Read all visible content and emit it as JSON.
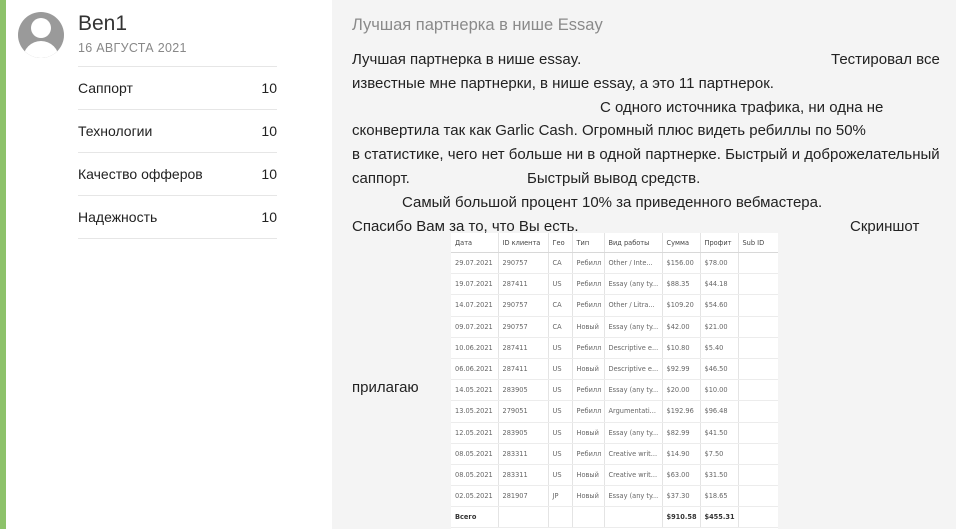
{
  "user": {
    "name": "Ben1",
    "date": "16 АВГУСТА 2021",
    "avatar_icon": "user-avatar-icon"
  },
  "ratings": [
    {
      "label": "Саппорт",
      "value": "10"
    },
    {
      "label": "Технологии",
      "value": "10"
    },
    {
      "label": "Качество офферов",
      "value": "10"
    },
    {
      "label": "Надежность",
      "value": "10"
    }
  ],
  "review": {
    "title": "Лучшая партнерка в нише Essay",
    "line1a": "Лучшая партнерка в нише essay.",
    "line1b": "Тестировал все",
    "line2": "известные мне партнерки, в нише essay, а это 11 партнерок.",
    "line3": "С одного источника трафика, ни одна не",
    "line4": "сконвертила так как Garlic Cash. Огромный плюс видеть ребиллы по 50%",
    "line5": "в статистике, чего нет больше ни в одной партнерке. Быстрый и доброжелательный",
    "line6a": "саппорт.",
    "line6b": "Быстрый вывод средств.",
    "line7": "Самый большой процент 10%  за приведенного вебмастера.",
    "line8a": "Спасибо Вам за то, что Вы есть.",
    "line8b": "Скриншот",
    "attach_caption": "прилагаю"
  },
  "screenshot_table": {
    "headers": [
      "Дата",
      "ID клиента",
      "Гео",
      "Тип",
      "Вид работы",
      "Сумма",
      "Профит",
      "Sub ID"
    ],
    "rows": [
      [
        "29.07.2021",
        "290757",
        "CA",
        "Ребилл",
        "Other / Inte...",
        "$156.00",
        "$78.00",
        ""
      ],
      [
        "19.07.2021",
        "287411",
        "US",
        "Ребилл",
        "Essay (any ty...",
        "$88.35",
        "$44.18",
        ""
      ],
      [
        "14.07.2021",
        "290757",
        "CA",
        "Ребилл",
        "Other / Litra...",
        "$109.20",
        "$54.60",
        ""
      ],
      [
        "09.07.2021",
        "290757",
        "CA",
        "Новый",
        "Essay (any ty...",
        "$42.00",
        "$21.00",
        ""
      ],
      [
        "10.06.2021",
        "287411",
        "US",
        "Ребилл",
        "Descriptive e...",
        "$10.80",
        "$5.40",
        ""
      ],
      [
        "06.06.2021",
        "287411",
        "US",
        "Новый",
        "Descriptive e...",
        "$92.99",
        "$46.50",
        ""
      ],
      [
        "14.05.2021",
        "283905",
        "US",
        "Ребилл",
        "Essay (any ty...",
        "$20.00",
        "$10.00",
        ""
      ],
      [
        "13.05.2021",
        "279051",
        "US",
        "Ребилл",
        "Argumentati...",
        "$192.96",
        "$96.48",
        ""
      ],
      [
        "12.05.2021",
        "283905",
        "US",
        "Новый",
        "Essay (any ty...",
        "$82.99",
        "$41.50",
        ""
      ],
      [
        "08.05.2021",
        "283311",
        "US",
        "Ребилл",
        "Creative writ...",
        "$14.90",
        "$7.50",
        ""
      ],
      [
        "08.05.2021",
        "283311",
        "US",
        "Новый",
        "Creative writ...",
        "$63.00",
        "$31.50",
        ""
      ],
      [
        "02.05.2021",
        "281907",
        "JP",
        "Новый",
        "Essay (any ty...",
        "$37.30",
        "$18.65",
        ""
      ]
    ],
    "total": [
      "Всего",
      "",
      "",
      "",
      "",
      "$910.58",
      "$455.31",
      ""
    ]
  },
  "colors": {
    "accent": "#8dc26a",
    "main_background": "#f4f4f4",
    "muted_text": "#8a8a8a"
  }
}
